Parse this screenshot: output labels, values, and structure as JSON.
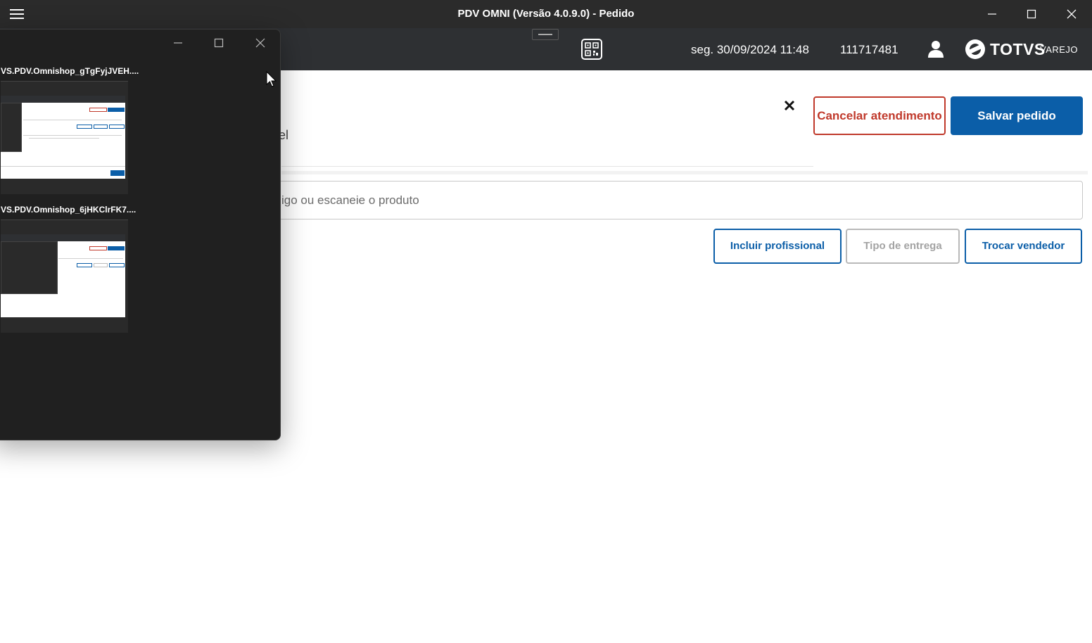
{
  "window": {
    "title": "PDV OMNI (Versão 4.0.9.0) - Pedido",
    "controls": [
      "minimize-icon",
      "maximize-icon",
      "close-icon"
    ]
  },
  "header": {
    "datetime": "seg. 30/09/2024 11:48",
    "terminal_id": "111717481",
    "logo_brand": "TOTVS",
    "logo_sub": "VAREJO",
    "icons": [
      "qr-code-icon",
      "user-icon"
    ]
  },
  "actions": {
    "cancel_label": "Cancelar atendimento",
    "save_label": "Salvar pedido"
  },
  "partial_text": "el",
  "search": {
    "placeholder_visible": "igo ou escaneie o produto"
  },
  "buttons": {
    "include_professional": "Incluir profissional",
    "delivery_type": "Tipo de entrega",
    "change_seller": "Trocar vendedor"
  },
  "overlay": {
    "items": [
      {
        "label": "VS.PDV.Omnishop_gTgFyjJVEH...."
      },
      {
        "label": "VS.PDV.Omnishop_6jHKClrFK7...."
      }
    ]
  },
  "colors": {
    "primary": "#0b5ea8",
    "danger": "#c0392b",
    "titlebar": "#2b2b2b",
    "header": "#2e3033"
  }
}
